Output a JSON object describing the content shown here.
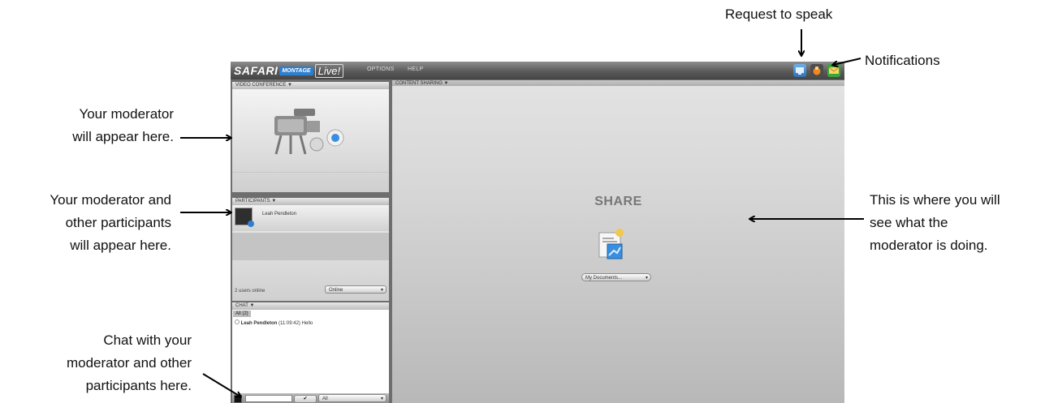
{
  "annotations": {
    "request_to_speak": "Request to speak",
    "notifications": "Notifications",
    "moderator_line1": "Your moderator",
    "moderator_line2": "will appear here.",
    "participants_line1": "Your moderator and",
    "participants_line2": "other participants",
    "participants_line3": "will appear here.",
    "chat_line1": "Chat with your",
    "chat_line2": "moderator and other",
    "chat_line3": "participants here.",
    "share_line1": "This is where you will",
    "share_line2": "see what the",
    "share_line3": "moderator is doing."
  },
  "app": {
    "logo_brand": "SAFARI",
    "logo_montage": "MONTAGE",
    "logo_live": "Live!",
    "menu_options": "OPTIONS",
    "menu_help": "HELP",
    "icons": [
      "screen-share-icon",
      "raise-hand-icon",
      "notifications-icon"
    ],
    "video_conference": {
      "header": "VIDEO CONFERENCE ▼"
    },
    "participants": {
      "header": "PARTICIPANTS ▼",
      "users": [
        {
          "name": "Leah Pendleton"
        }
      ],
      "users_online": "2 users online",
      "status_select": "Online"
    },
    "chat": {
      "header": "CHAT ▼",
      "tab": "All (2)",
      "message_sender": "Leah Pendleton",
      "message_time": "(11:09:42)",
      "message_text": "Hello",
      "recipient_select": "All"
    },
    "content_sharing": {
      "header": "CONTENT SHARING ▼",
      "title": "SHARE",
      "documents_select": "My Documents..."
    }
  },
  "colors": {
    "accent_blue": "#2f7fd0",
    "toolbar_green": "#3aa63a",
    "hand_orange": "#f08a1c"
  }
}
